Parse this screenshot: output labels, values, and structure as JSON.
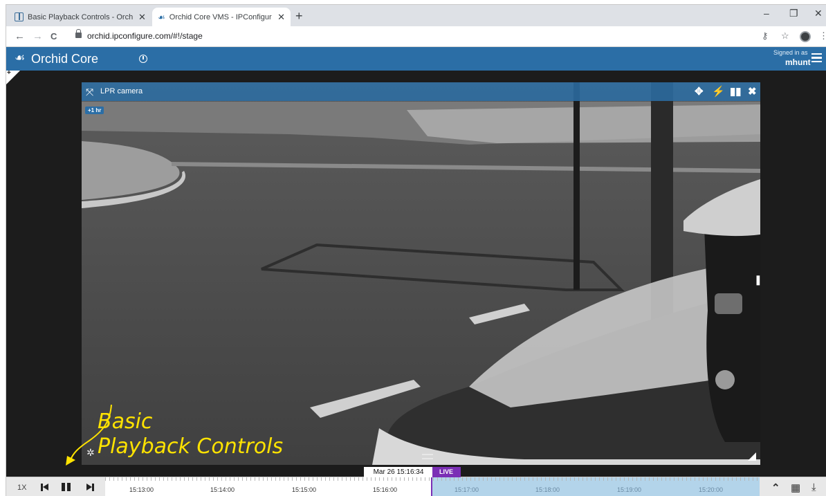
{
  "browser": {
    "tabs": [
      {
        "title": "Basic Playback Controls - Orchid",
        "active": false,
        "icon": "document-icon"
      },
      {
        "title": "Orchid Core VMS - IPConfigure, I",
        "active": true,
        "icon": "orchid-logo-icon"
      }
    ],
    "new_tab": "+",
    "window_controls": {
      "minimize": "–",
      "restore": "❐",
      "close": "✕"
    },
    "nav": {
      "back": "←",
      "forward": "→",
      "reload": "C"
    },
    "url": "orchid.ipconfigure.com/#!/stage",
    "icons": {
      "key": "⚷",
      "star": "☆",
      "more": "⋮"
    }
  },
  "app": {
    "title": "Orchid Core",
    "logo": "orchid-logo-icon",
    "signed_in_label": "Signed in as",
    "user": "mhunt",
    "accent_color": "#2b6ea6"
  },
  "camera": {
    "name": "LPR camera",
    "time_offset_badge": "+1 hr",
    "header_icons": [
      "ptz-icon",
      "bolt-icon",
      "stats-icon",
      "close-icon"
    ]
  },
  "annotation": {
    "line1": "Basic",
    "line2": "Playback Controls",
    "color": "#ffe300"
  },
  "playback": {
    "speed": "1X",
    "current_datetime": "Mar 26 15:16:34",
    "live_label": "LIVE",
    "live_color": "#7b2fb5",
    "timeline_ticks": [
      "15:13:00",
      "15:14:00",
      "15:15:00",
      "15:16:00",
      "15:17:00",
      "15:18:00",
      "15:19:00",
      "15:20:00"
    ]
  }
}
